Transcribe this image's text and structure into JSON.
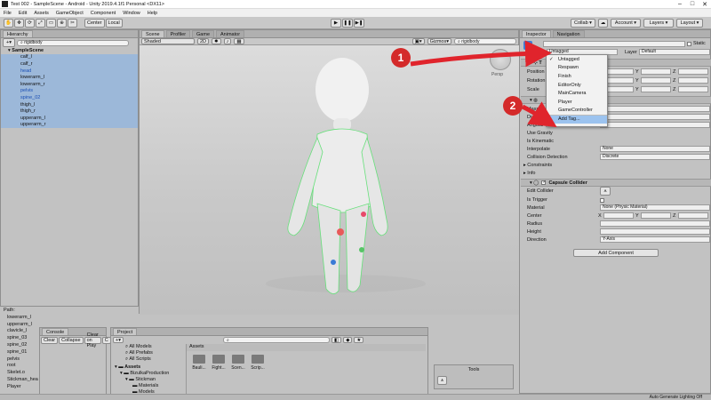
{
  "window": {
    "title": "Test 002 - SampleScene - Android - Unity 2019.4.1f1 Personal <DX11>"
  },
  "menu": [
    "File",
    "Edit",
    "Assets",
    "GameObject",
    "Component",
    "Window",
    "Help"
  ],
  "toolbar": {
    "center": "Center",
    "local": "Local",
    "collab": "Collab",
    "account": "Account",
    "layers": "Layers",
    "layout": "Layout"
  },
  "hierarchy": {
    "tab": "Hierarchy",
    "search": "rigidbody",
    "scene": "SampleScene",
    "items": [
      "calf_l",
      "calf_r",
      "head",
      "lowerarm_l",
      "lowerarm_r",
      "pelvis",
      "spine_02",
      "thigh_l",
      "thigh_r",
      "upperarm_l",
      "upperarm_r"
    ]
  },
  "path": {
    "label": "Path:",
    "items": [
      "lowerarm_l",
      "upperarm_l",
      "clavicle_l",
      "spine_03",
      "spine_02",
      "spine_01",
      "pelvis",
      "root",
      "Skelet.o",
      "Stickman_hea",
      "Player"
    ]
  },
  "scene": {
    "tabs": [
      "Scene",
      "Profiler",
      "Game",
      "Animator"
    ],
    "shading": "Shaded",
    "mode2d": "2D",
    "gizmos": "Gizmos",
    "search": "rigidbody",
    "persp": "Persp"
  },
  "console": {
    "tab": "Console",
    "buttons": [
      "Clear",
      "Collapse",
      "Clear on Play",
      "C"
    ]
  },
  "project": {
    "tab": "Project",
    "favorites": [
      "All Models",
      "All Prefabs",
      "All Scripts"
    ],
    "tree": [
      "Assets",
      "BizulkaProduction",
      "Stickman",
      "Materials",
      "Models"
    ],
    "breadcrumb": "Assets",
    "folders": [
      "Bauli...",
      "Fight...",
      "Scen...",
      "Scrip..."
    ]
  },
  "tools": {
    "title": "Tools"
  },
  "inspector": {
    "tabs": [
      "Inspector",
      "Navigation"
    ],
    "static": "Static",
    "tag_label": "Tag",
    "tag_value": "Untagged",
    "layer_label": "Layer",
    "layer_value": "Default",
    "transform": {
      "position": "Position",
      "rotation": "Rotation",
      "scale": "Scale"
    },
    "axes": [
      "X",
      "Y",
      "Z"
    ],
    "rigidbody": {
      "mass": "Mass",
      "drag": "Drag",
      "angular": "Angular",
      "use_gravity": "Use Gravity",
      "is_kinematic": "Is Kinematic",
      "interpolate": "Interpolate",
      "interpolate_value": "None",
      "collision": "Collision Detection",
      "collision_value": "Discrete",
      "constraints": "Constraints",
      "info": "Info"
    },
    "capsule": {
      "title": "Capsule Collider",
      "edit": "Edit Collider",
      "trigger": "Is Trigger",
      "material": "Material",
      "material_value": "None (Physic Material)",
      "center": "Center",
      "radius": "Radius",
      "height": "Height",
      "direction": "Direction",
      "direction_value": "Y-Axis"
    },
    "add_component": "Add Component"
  },
  "dropdown": {
    "items": [
      "Untagged",
      "Respawn",
      "Finish",
      "EditorOnly",
      "MainCamera",
      "Player",
      "GameController",
      "Add Tag..."
    ]
  },
  "annotations": {
    "one": "1",
    "two": "2"
  },
  "status": {
    "text": "Auto Generate Lighting Off"
  },
  "colors": {
    "arrow": "#e0242c",
    "selection": "#9cb8d9",
    "highlight": "#9cc3ef"
  }
}
